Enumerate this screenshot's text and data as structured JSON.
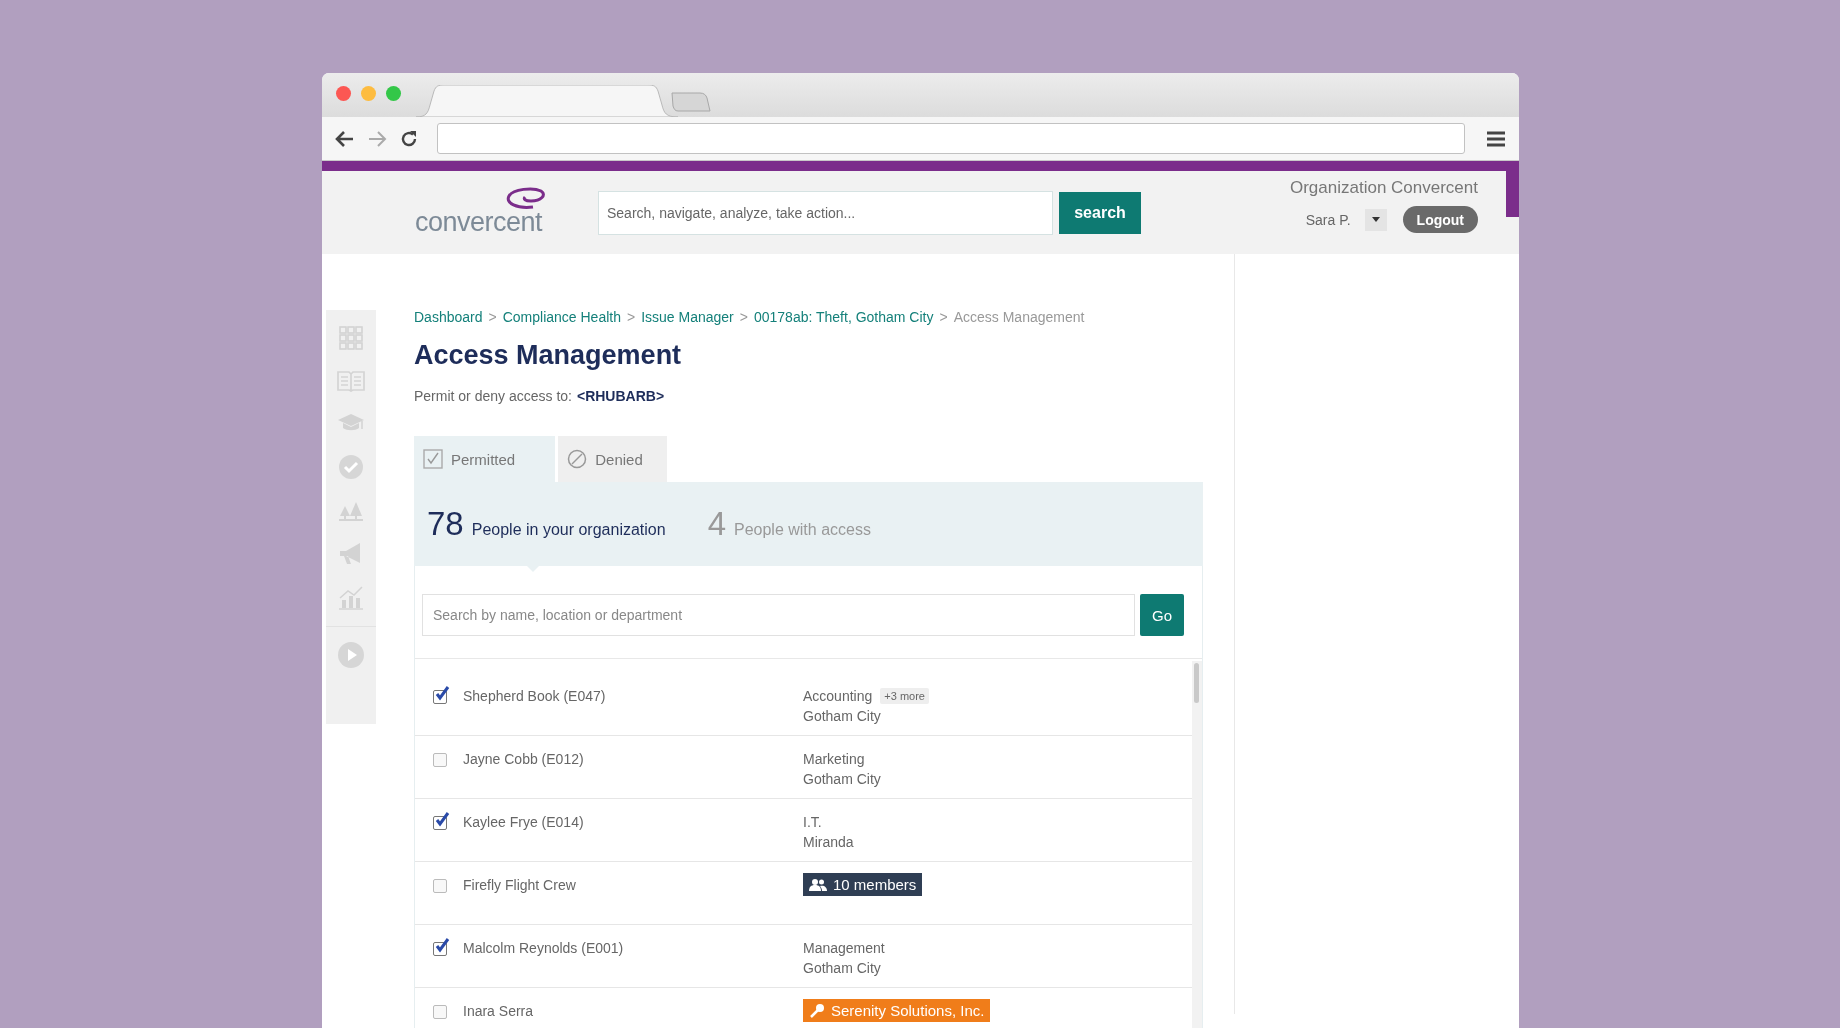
{
  "header": {
    "logo_text": "convercent",
    "search_placeholder": "Search, navigate, analyze, take action...",
    "search_button": "search",
    "organization": "Organization Convercent",
    "user": "Sara P.",
    "logout": "Logout"
  },
  "breadcrumb": [
    {
      "label": "Dashboard",
      "kind": "link"
    },
    {
      "label": "Compliance Health",
      "kind": "link"
    },
    {
      "label": "Issue Manager",
      "kind": "link"
    },
    {
      "label": "00178ab: Theft, Gotham City",
      "kind": "link"
    },
    {
      "label": "Access Management",
      "kind": "current"
    }
  ],
  "separator": ">",
  "title": "Access Management",
  "subtitle": {
    "text": "Permit or deny access to:",
    "target": "<RHUBARB>"
  },
  "tabs": [
    {
      "label": "Permitted",
      "kind": "permitted",
      "selected": true
    },
    {
      "label": "Denied",
      "kind": "denied",
      "selected": false
    }
  ],
  "stats": [
    {
      "count": "78",
      "label": "People in your organization",
      "selected": true
    },
    {
      "count": "4",
      "label": "People with access",
      "selected": false
    }
  ],
  "list_search": {
    "placeholder": "Search by name, location or department",
    "button": "Go"
  },
  "people": [
    {
      "kind": "person",
      "name": "Shepherd Book (E047)",
      "checked": true,
      "department": "Accounting",
      "more": "+3 more",
      "location": "Gotham City"
    },
    {
      "kind": "person",
      "name": "Jayne Cobb (E012)",
      "checked": false,
      "department": "Marketing",
      "location": "Gotham City"
    },
    {
      "kind": "person",
      "name": "Kaylee Frye (E014)",
      "checked": true,
      "department": "I.T.",
      "location": "Miranda"
    },
    {
      "kind": "group",
      "name": "Firefly Flight Crew",
      "checked": false,
      "badge": "10 members"
    },
    {
      "kind": "person",
      "name": "Malcolm Reynolds (E001)",
      "checked": true,
      "department": "Management",
      "location": "Gotham City"
    },
    {
      "kind": "vendor",
      "name": "Inara Serra",
      "checked": false,
      "badge": "Serenity Solutions, Inc."
    }
  ]
}
